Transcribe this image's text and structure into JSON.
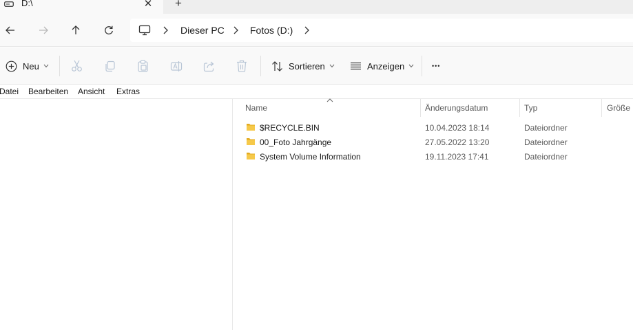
{
  "window": {
    "tab_title": "D:\\",
    "tab_close_glyph": "✕",
    "new_tab_glyph": "+"
  },
  "nav": {
    "breadcrumbs": [
      "Dieser PC",
      "Fotos (D:)"
    ]
  },
  "commands": {
    "new_label": "Neu",
    "sort_label": "Sortieren",
    "view_label": "Anzeigen",
    "more_glyph": "•••"
  },
  "menu": [
    "Datei",
    "Bearbeiten",
    "Ansicht",
    "Extras"
  ],
  "table": {
    "columns": [
      "Name",
      "Änderungsdatum",
      "Typ",
      "Größe"
    ],
    "rows": [
      {
        "name": "$RECYCLE.BIN",
        "date": "10.04.2023 18:14",
        "type": "Dateiordner"
      },
      {
        "name": "00_Foto Jahrgänge",
        "date": "27.05.2022 13:20",
        "type": "Dateiordner"
      },
      {
        "name": "System Volume Information",
        "date": "19.11.2023 17:41",
        "type": "Dateiordner"
      }
    ]
  },
  "icons": {
    "tab": "drive-icon",
    "back": "arrow-left-icon",
    "forward": "arrow-right-icon",
    "up": "arrow-up-icon",
    "refresh": "refresh-icon",
    "location": "computer-icon",
    "new": "plus-circle-icon",
    "cut": "scissors-icon",
    "copy": "copy-icon",
    "paste": "paste-icon",
    "rename": "rename-icon",
    "share": "share-icon",
    "delete": "trash-icon",
    "sort": "sort-icon",
    "view": "view-lines-icon",
    "folder": "folder-icon"
  },
  "colors": {
    "folder": "#f6c94a",
    "folder_dark": "#e3aa1f",
    "disabled_icon": "#b9c6d6",
    "accent": "#1b1b1b"
  }
}
